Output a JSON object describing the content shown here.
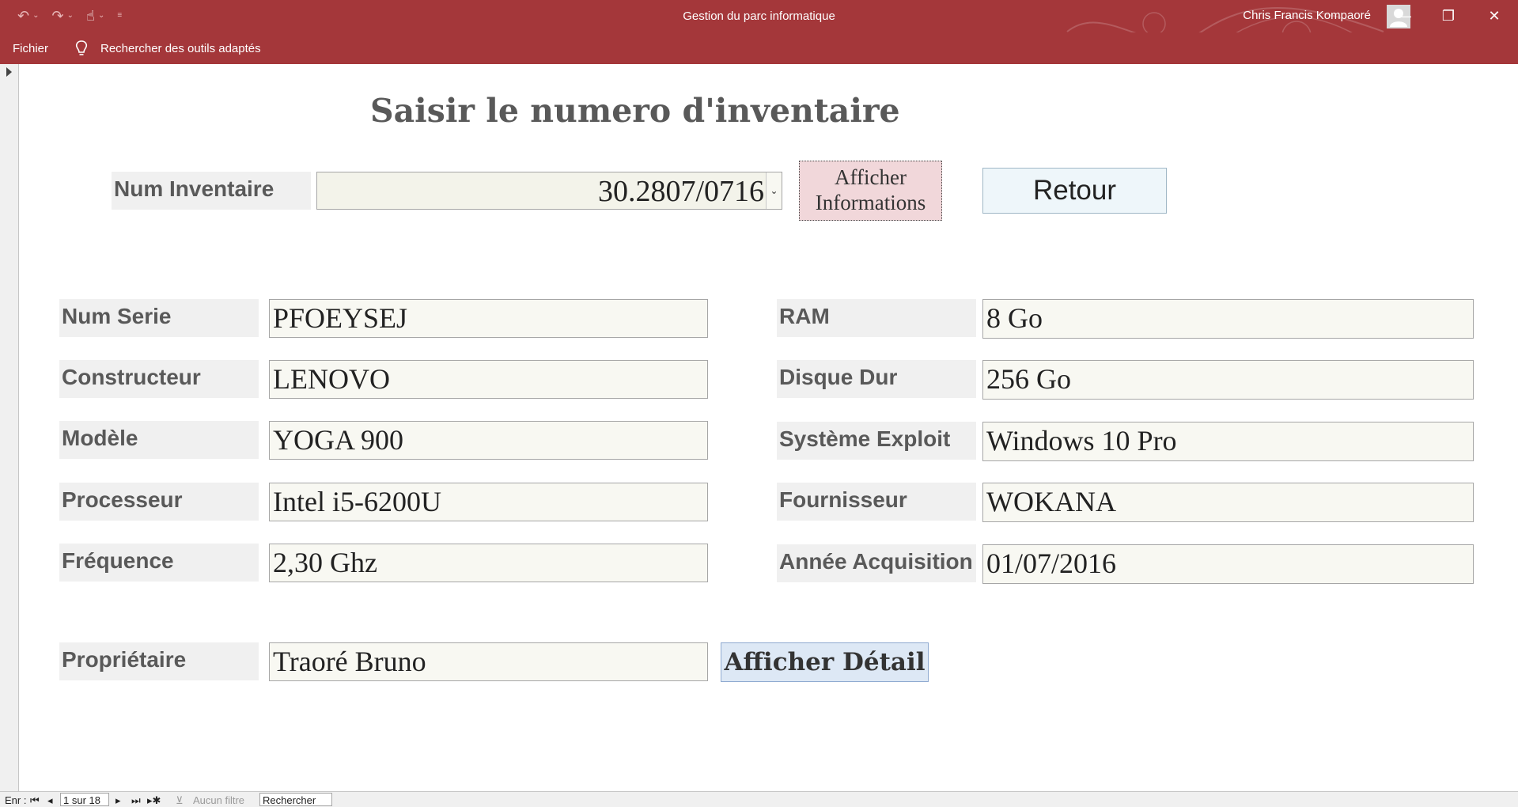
{
  "window": {
    "title": "Gestion du parc informatique",
    "user": "Chris Francis Kompaoré",
    "controls": {
      "minimize": "—",
      "restore": "❐",
      "close": "✕"
    }
  },
  "ribbon": {
    "file_tab": "Fichier",
    "tell_me": "Rechercher des outils adaptés"
  },
  "form": {
    "title": "Saisir le numero d'inventaire",
    "inventory_label": "Num Inventaire",
    "inventory_value": "30.2807/0716",
    "show_info_button": [
      "Afficher",
      "Informations"
    ],
    "back_button": "Retour",
    "left_fields": [
      {
        "label": "Num Serie",
        "value": "PFOEYSEJ"
      },
      {
        "label": "Constructeur",
        "value": "LENOVO"
      },
      {
        "label": "Modèle",
        "value": "YOGA 900"
      },
      {
        "label": "Processeur",
        "value": "Intel i5-6200U"
      },
      {
        "label": "Fréquence",
        "value": "2,30 Ghz"
      }
    ],
    "right_fields": [
      {
        "label": "RAM",
        "value": "8 Go"
      },
      {
        "label": "Disque Dur",
        "value": "256 Go"
      },
      {
        "label": "Système Exploit",
        "value": "Windows 10 Pro"
      },
      {
        "label": "Fournisseur",
        "value": "WOKANA"
      },
      {
        "label": "Année Acquisition",
        "value": "01/07/2016"
      }
    ],
    "owner_label": "Propriétaire",
    "owner_value": "Traoré Bruno",
    "detail_button": "Afficher Détail"
  },
  "record_nav": {
    "record_label": "Enr :",
    "position": "1 sur 18",
    "filter": "Aucun filtre",
    "search": "Rechercher"
  },
  "icons": [
    "undo-icon",
    "redo-icon",
    "touch-mode-icon",
    "customize-qat-icon",
    "avatar-icon",
    "lightbulb-icon",
    "nav-pane-expand-icon",
    "first-record-icon",
    "prev-record-icon",
    "next-record-icon",
    "last-record-icon",
    "new-record-icon",
    "filter-icon"
  ],
  "colors": {
    "titlebar": "#a4373a",
    "label_bg": "#f0f0f0",
    "field_bg": "#f8f8f2",
    "info_button_bg": "#f1d7da",
    "back_button_bg": "#eef6fa",
    "detail_button_bg": "#dde8f5"
  }
}
